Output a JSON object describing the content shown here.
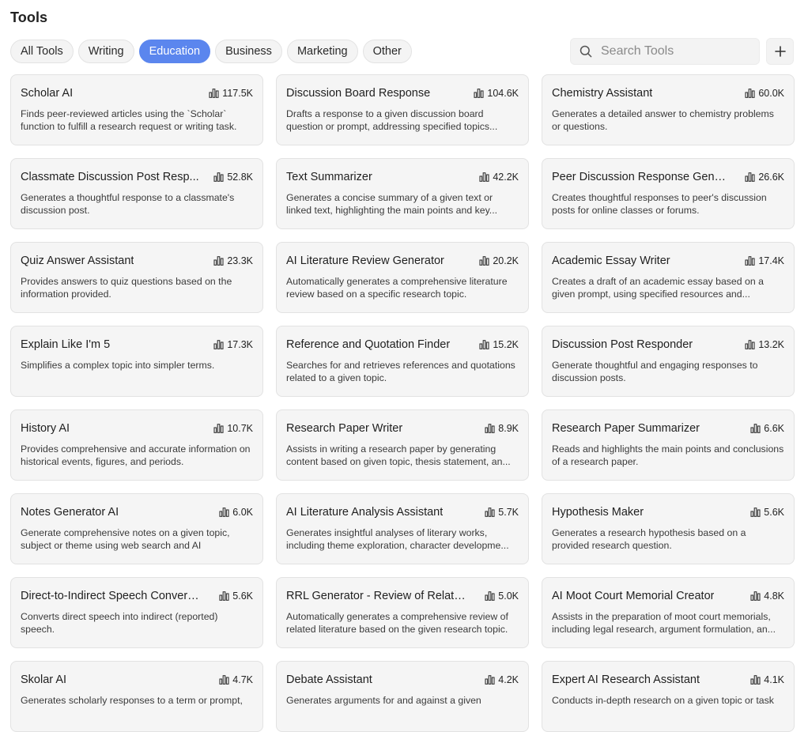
{
  "page": {
    "title": "Tools"
  },
  "filters": [
    {
      "label": "All Tools",
      "active": false
    },
    {
      "label": "Writing",
      "active": false
    },
    {
      "label": "Education",
      "active": true
    },
    {
      "label": "Business",
      "active": false
    },
    {
      "label": "Marketing",
      "active": false
    },
    {
      "label": "Other",
      "active": false
    }
  ],
  "search": {
    "placeholder": "Search Tools",
    "value": ""
  },
  "add_button": {
    "label": "+"
  },
  "icons": {
    "search": "search-icon",
    "usage": "bar-chart-icon",
    "add": "plus-icon"
  },
  "colors": {
    "accent": "#5b86ee",
    "card_bg": "#f5f5f5",
    "card_border": "#e2e2e2"
  },
  "tools": [
    {
      "title": "Scholar AI",
      "count": "117.5K",
      "description": "Finds peer-reviewed articles using the `Scholar` function to fulfill a research request or writing task."
    },
    {
      "title": "Discussion Board Response",
      "count": "104.6K",
      "description": "Drafts a response to a given discussion board question or prompt, addressing specified topics..."
    },
    {
      "title": "Chemistry Assistant",
      "count": "60.0K",
      "description": "Generates a detailed answer to chemistry problems or questions."
    },
    {
      "title": "Classmate Discussion Post Resp...",
      "count": "52.8K",
      "description": "Generates a thoughtful response to a classmate's discussion post."
    },
    {
      "title": "Text Summarizer",
      "count": "42.2K",
      "description": "Generates a concise summary of a given text or linked text, highlighting the main points and key..."
    },
    {
      "title": "Peer Discussion Response Gener...",
      "count": "26.6K",
      "description": "Creates thoughtful responses to peer's discussion posts for online classes or forums."
    },
    {
      "title": "Quiz Answer Assistant",
      "count": "23.3K",
      "description": "Provides answers to quiz questions based on the information provided."
    },
    {
      "title": "AI Literature Review Generator",
      "count": "20.2K",
      "description": "Automatically generates a comprehensive literature review based on a specific research topic."
    },
    {
      "title": "Academic Essay Writer",
      "count": "17.4K",
      "description": "Creates a draft of an academic essay based on a given prompt, using specified resources and..."
    },
    {
      "title": "Explain Like I'm 5",
      "count": "17.3K",
      "description": "Simplifies a complex topic into simpler terms."
    },
    {
      "title": "Reference and Quotation Finder",
      "count": "15.2K",
      "description": "Searches for and retrieves references and quotations related to a given topic."
    },
    {
      "title": "Discussion Post Responder",
      "count": "13.2K",
      "description": "Generate thoughtful and engaging responses to discussion posts."
    },
    {
      "title": "History AI",
      "count": "10.7K",
      "description": "Provides comprehensive and accurate information on historical events, figures, and periods."
    },
    {
      "title": "Research Paper Writer",
      "count": "8.9K",
      "description": "Assists in writing a research paper by generating content based on given topic, thesis statement, an..."
    },
    {
      "title": "Research Paper Summarizer",
      "count": "6.6K",
      "description": "Reads and highlights the main points and conclusions of a research paper."
    },
    {
      "title": "Notes Generator AI",
      "count": "6.0K",
      "description": "Generate comprehensive notes on a given topic, subject or theme using web search and AI"
    },
    {
      "title": "AI Literature Analysis Assistant",
      "count": "5.7K",
      "description": "Generates insightful analyses of literary works, including theme exploration, character developme..."
    },
    {
      "title": "Hypothesis Maker",
      "count": "5.6K",
      "description": "Generates a research hypothesis based on a provided research question."
    },
    {
      "title": "Direct-to-Indirect Speech Converter",
      "count": "5.6K",
      "description": "Converts direct speech into indirect (reported) speech."
    },
    {
      "title": "RRL Generator - Review of Related...",
      "count": "5.0K",
      "description": "Automatically generates a comprehensive review of related literature based on the given research topic."
    },
    {
      "title": "AI Moot Court Memorial Creator",
      "count": "4.8K",
      "description": "Assists in the preparation of moot court memorials, including legal research, argument formulation, an..."
    },
    {
      "title": "Skolar AI",
      "count": "4.7K",
      "description": "Generates scholarly responses to a term or prompt,"
    },
    {
      "title": "Debate Assistant",
      "count": "4.2K",
      "description": "Generates arguments for and against a given"
    },
    {
      "title": "Expert AI Research Assistant",
      "count": "4.1K",
      "description": "Conducts in-depth research on a given topic or task"
    }
  ]
}
